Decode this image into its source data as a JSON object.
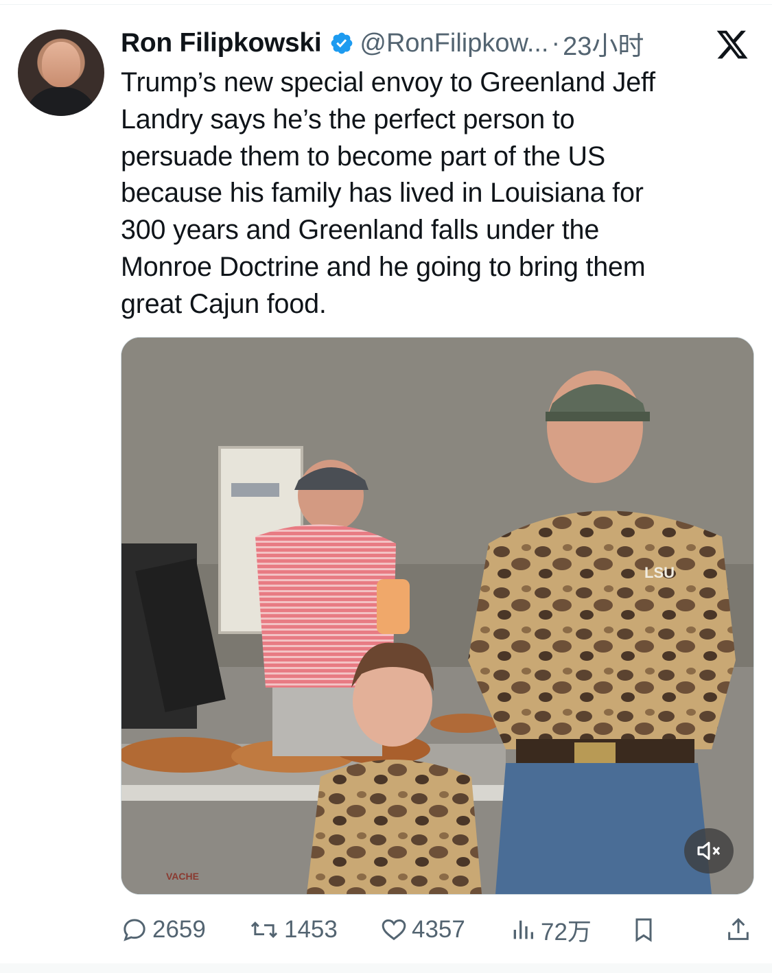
{
  "author": {
    "name": "Ron Filipkowski",
    "handle": "@RonFilipkow...",
    "separator": "·",
    "time": "23小时",
    "verified": true,
    "verified_color": "#1d9bf0"
  },
  "platform_icon": "x-logo-icon",
  "tweet": {
    "text": "Trump’s new special envoy to Greenland Jeff\nLandry says he’s the perfect person to\npersuade them to become part of the US\nbecause his family has lived in Louisiana for\n300 years and Greenland falls under the\nMonroe Doctrine and he going to bring them\ngreat Cajun food."
  },
  "media": {
    "type": "video",
    "shirt_logo": "LSU",
    "sign_text": "VACHE",
    "mute_icon": "speaker-muted-icon"
  },
  "actions": {
    "replies": "2659",
    "reposts": "1453",
    "likes": "4357",
    "views": "72万",
    "icons": [
      "reply-icon",
      "repost-icon",
      "like-icon",
      "views-icon",
      "bookmark-icon",
      "share-icon"
    ]
  },
  "colors": {
    "text": "#0f1419",
    "muted": "#536471",
    "accent": "#1d9bf0"
  }
}
